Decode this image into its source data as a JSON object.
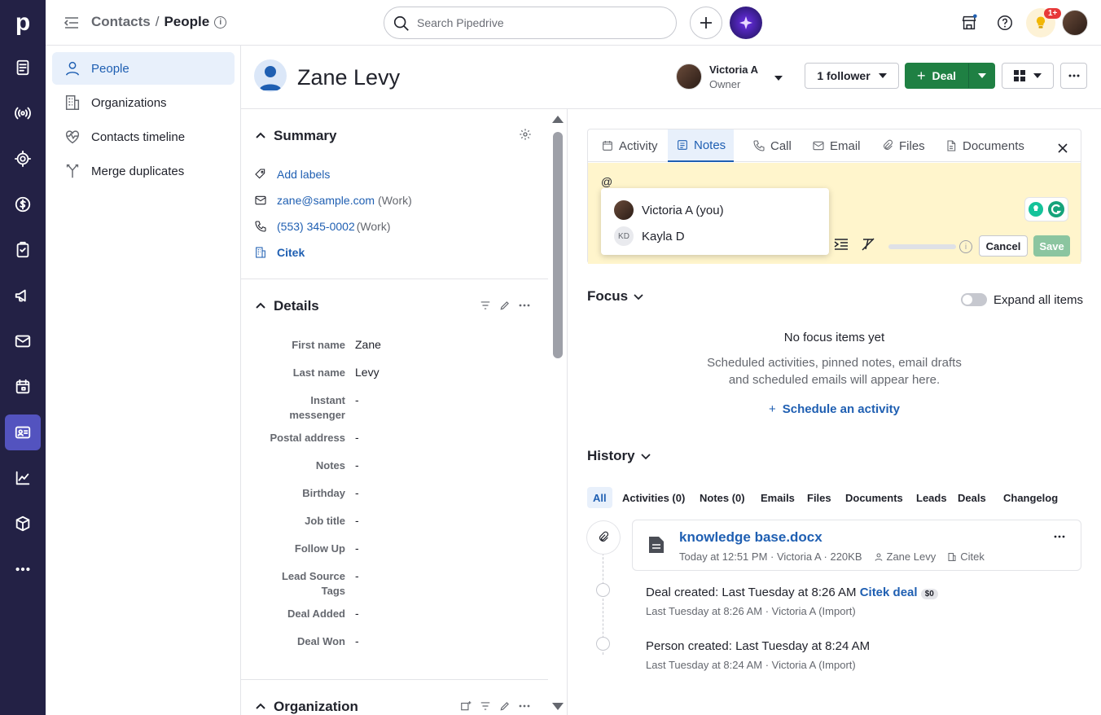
{
  "app": {
    "logo": "p"
  },
  "breadcrumb": {
    "section": "Contacts",
    "sep": "/",
    "current": "People"
  },
  "search": {
    "placeholder": "Search Pipedrive"
  },
  "notifications": {
    "badge": "1+"
  },
  "subnav": {
    "items": [
      {
        "label": "People",
        "icon": "person-icon"
      },
      {
        "label": "Organizations",
        "icon": "building-icon"
      },
      {
        "label": "Contacts timeline",
        "icon": "heart-pulse-icon"
      },
      {
        "label": "Merge duplicates",
        "icon": "merge-icon"
      }
    ]
  },
  "person": {
    "name": "Zane Levy"
  },
  "owner": {
    "name": "Victoria A",
    "role": "Owner"
  },
  "header_buttons": {
    "follower": "1 follower",
    "deal": "Deal"
  },
  "summary": {
    "title": "Summary",
    "add_labels": "Add labels",
    "email": "zane@sample.com",
    "email_type": "(Work)",
    "phone": "(553) 345-0002",
    "phone_type": "(Work)",
    "org": "Citek"
  },
  "details": {
    "title": "Details",
    "fields": [
      {
        "label": "First name",
        "value": "Zane"
      },
      {
        "label": "Last name",
        "value": "Levy"
      },
      {
        "label": "Instant messenger",
        "value": "-"
      },
      {
        "label": "Postal address",
        "value": "-"
      },
      {
        "label": "Notes",
        "value": "-"
      },
      {
        "label": "Birthday",
        "value": "-"
      },
      {
        "label": "Job title",
        "value": "-"
      },
      {
        "label": "Follow Up",
        "value": "-"
      },
      {
        "label": "Lead Source Tags",
        "value": "-"
      },
      {
        "label": "Deal Added",
        "value": "-"
      },
      {
        "label": "Deal Won",
        "value": "-"
      }
    ]
  },
  "organization_section": {
    "title": "Organization"
  },
  "composer": {
    "tabs": [
      "Activity",
      "Notes",
      "Call",
      "Email",
      "Files",
      "Documents"
    ],
    "active_tab": "Notes",
    "text": "@",
    "mentions": [
      {
        "name": "Victoria A (you)",
        "initials": ""
      },
      {
        "name": "Kayla D",
        "initials": "KD"
      }
    ],
    "cancel": "Cancel",
    "save": "Save"
  },
  "focus": {
    "title": "Focus",
    "expand_label": "Expand all items",
    "empty_title": "No focus items yet",
    "empty_line1": "Scheduled activities, pinned notes, email drafts",
    "empty_line2": "and scheduled emails will appear here.",
    "schedule": "Schedule an activity"
  },
  "history": {
    "title": "History",
    "filters": [
      "All",
      "Activities (0)",
      "Notes (0)",
      "Emails",
      "Files",
      "Documents",
      "Leads",
      "Deals",
      "Changelog"
    ],
    "file": {
      "name": "knowledge base.docx",
      "meta": "Today at 12:51 PM · Victoria A · 220KB",
      "person": "Zane Levy",
      "org": "Citek"
    },
    "events": [
      {
        "label": "Deal created",
        "time": "Last Tuesday at 8:26 AM",
        "link": "Citek deal",
        "badge": "$0",
        "sub": "Last Tuesday at 8:26 AM · Victoria A (Import)"
      },
      {
        "label": "Person created",
        "time": "Last Tuesday at 8:24 AM",
        "sub": "Last Tuesday at 8:24 AM · Victoria A (Import)"
      }
    ]
  }
}
